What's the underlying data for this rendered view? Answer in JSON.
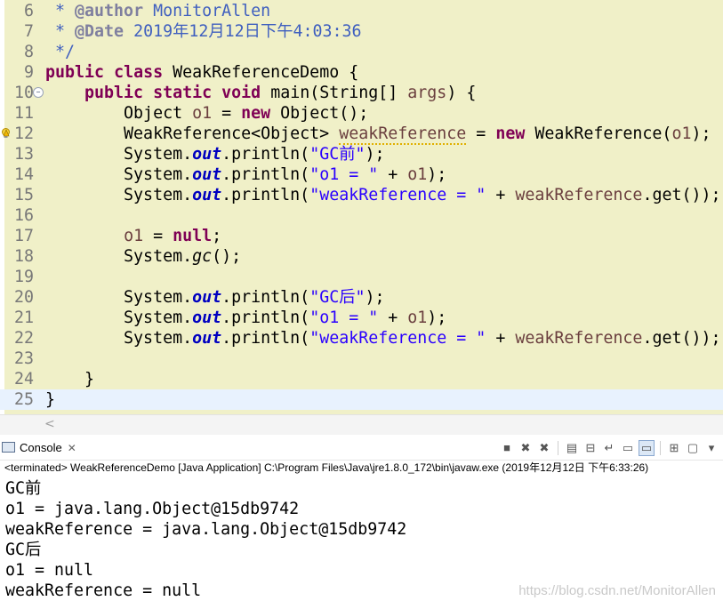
{
  "editor": {
    "lines": [
      {
        "num": "6",
        "tokens": [
          {
            "t": " * ",
            "c": "cm"
          },
          {
            "t": "@author",
            "c": "tag"
          },
          {
            "t": " MonitorAllen",
            "c": "cm"
          }
        ]
      },
      {
        "num": "7",
        "tokens": [
          {
            "t": " * ",
            "c": "cm"
          },
          {
            "t": "@Date",
            "c": "tag"
          },
          {
            "t": " 2019年12月12日下午4:03:36",
            "c": "cm"
          }
        ]
      },
      {
        "num": "8",
        "tokens": [
          {
            "t": " */",
            "c": "cm"
          }
        ]
      },
      {
        "num": "9",
        "tokens": [
          {
            "t": "public",
            "c": "kw"
          },
          {
            "t": " "
          },
          {
            "t": "class",
            "c": "kw"
          },
          {
            "t": " WeakReferenceDemo {"
          }
        ]
      },
      {
        "num": "10",
        "tokens": [
          {
            "t": "    "
          },
          {
            "t": "public",
            "c": "kw"
          },
          {
            "t": " "
          },
          {
            "t": "static",
            "c": "kw"
          },
          {
            "t": " "
          },
          {
            "t": "void",
            "c": "kw"
          },
          {
            "t": " main(String[] "
          },
          {
            "t": "args",
            "c": "var"
          },
          {
            "t": ") {"
          }
        ]
      },
      {
        "num": "11",
        "tokens": [
          {
            "t": "        Object "
          },
          {
            "t": "o1",
            "c": "var"
          },
          {
            "t": " = "
          },
          {
            "t": "new",
            "c": "kw"
          },
          {
            "t": " Object();"
          }
        ]
      },
      {
        "num": "12",
        "tokens": [
          {
            "t": "        WeakReference<Object> "
          },
          {
            "t": "weakReference",
            "c": "var warn"
          },
          {
            "t": " = "
          },
          {
            "t": "new",
            "c": "kw"
          },
          {
            "t": " WeakReference("
          },
          {
            "t": "o1",
            "c": "var"
          },
          {
            "t": ");"
          }
        ]
      },
      {
        "num": "13",
        "tokens": [
          {
            "t": "        System."
          },
          {
            "t": "out",
            "c": "fld"
          },
          {
            "t": ".println("
          },
          {
            "t": "\"GC前\"",
            "c": "str"
          },
          {
            "t": ");"
          }
        ]
      },
      {
        "num": "14",
        "tokens": [
          {
            "t": "        System."
          },
          {
            "t": "out",
            "c": "fld"
          },
          {
            "t": ".println("
          },
          {
            "t": "\"o1 = \"",
            "c": "str"
          },
          {
            "t": " + "
          },
          {
            "t": "o1",
            "c": "var"
          },
          {
            "t": ");"
          }
        ]
      },
      {
        "num": "15",
        "tokens": [
          {
            "t": "        System."
          },
          {
            "t": "out",
            "c": "fld"
          },
          {
            "t": ".println("
          },
          {
            "t": "\"weakReference = \"",
            "c": "str"
          },
          {
            "t": " + "
          },
          {
            "t": "weakReference",
            "c": "var"
          },
          {
            "t": ".get());"
          }
        ]
      },
      {
        "num": "16",
        "tokens": []
      },
      {
        "num": "17",
        "tokens": [
          {
            "t": "        "
          },
          {
            "t": "o1",
            "c": "var"
          },
          {
            "t": " = "
          },
          {
            "t": "null",
            "c": "kw"
          },
          {
            "t": ";"
          }
        ]
      },
      {
        "num": "18",
        "tokens": [
          {
            "t": "        System."
          },
          {
            "t": "gc",
            "c": "itl"
          },
          {
            "t": "();"
          }
        ]
      },
      {
        "num": "19",
        "tokens": []
      },
      {
        "num": "20",
        "tokens": [
          {
            "t": "        System."
          },
          {
            "t": "out",
            "c": "fld"
          },
          {
            "t": ".println("
          },
          {
            "t": "\"GC后\"",
            "c": "str"
          },
          {
            "t": ");"
          }
        ]
      },
      {
        "num": "21",
        "tokens": [
          {
            "t": "        System."
          },
          {
            "t": "out",
            "c": "fld"
          },
          {
            "t": ".println("
          },
          {
            "t": "\"o1 = \"",
            "c": "str"
          },
          {
            "t": " + "
          },
          {
            "t": "o1",
            "c": "var"
          },
          {
            "t": ");"
          }
        ]
      },
      {
        "num": "22",
        "tokens": [
          {
            "t": "        System."
          },
          {
            "t": "out",
            "c": "fld"
          },
          {
            "t": ".println("
          },
          {
            "t": "\"weakReference = \"",
            "c": "str"
          },
          {
            "t": " + "
          },
          {
            "t": "weakReference",
            "c": "var"
          },
          {
            "t": ".get());"
          }
        ]
      },
      {
        "num": "23",
        "tokens": []
      },
      {
        "num": "24",
        "tokens": [
          {
            "t": "    }"
          }
        ]
      },
      {
        "num": "25",
        "tokens": [
          {
            "t": "}"
          }
        ]
      }
    ],
    "current_line": "25",
    "fold_marker_line": "10",
    "warning_marker_line": "12",
    "scroll_left_glyph": "<"
  },
  "console": {
    "tab_label": "Console",
    "tab_close_glyph": "✕",
    "toolbar": [
      {
        "name": "terminate-icon",
        "glyph": "■"
      },
      {
        "name": "remove-launch-icon",
        "glyph": "✖"
      },
      {
        "name": "remove-all-terminated-icon",
        "glyph": "✖"
      },
      {
        "name": "sep"
      },
      {
        "name": "clear-console-icon",
        "glyph": "▤"
      },
      {
        "name": "scroll-lock-icon",
        "glyph": "⊟"
      },
      {
        "name": "word-wrap-icon",
        "glyph": "↵"
      },
      {
        "name": "show-on-stdout-icon",
        "glyph": "▭"
      },
      {
        "name": "show-on-stderr-icon",
        "glyph": "▭",
        "pressed": true
      },
      {
        "name": "sep"
      },
      {
        "name": "pin-console-icon",
        "glyph": "⊞"
      },
      {
        "name": "display-selected-console-icon",
        "glyph": "▢"
      },
      {
        "name": "open-console-dropdown-icon",
        "glyph": "▾"
      }
    ],
    "status": "<terminated> WeakReferenceDemo [Java Application] C:\\Program Files\\Java\\jre1.8.0_172\\bin\\javaw.exe (2019年12月12日 下午6:33:26)",
    "output": [
      "GC前",
      "o1 = java.lang.Object@15db9742",
      "weakReference = java.lang.Object@15db9742",
      "GC后",
      "o1 = null",
      "weakReference = null"
    ]
  },
  "watermark": "https://blog.csdn.net/MonitorAllen"
}
